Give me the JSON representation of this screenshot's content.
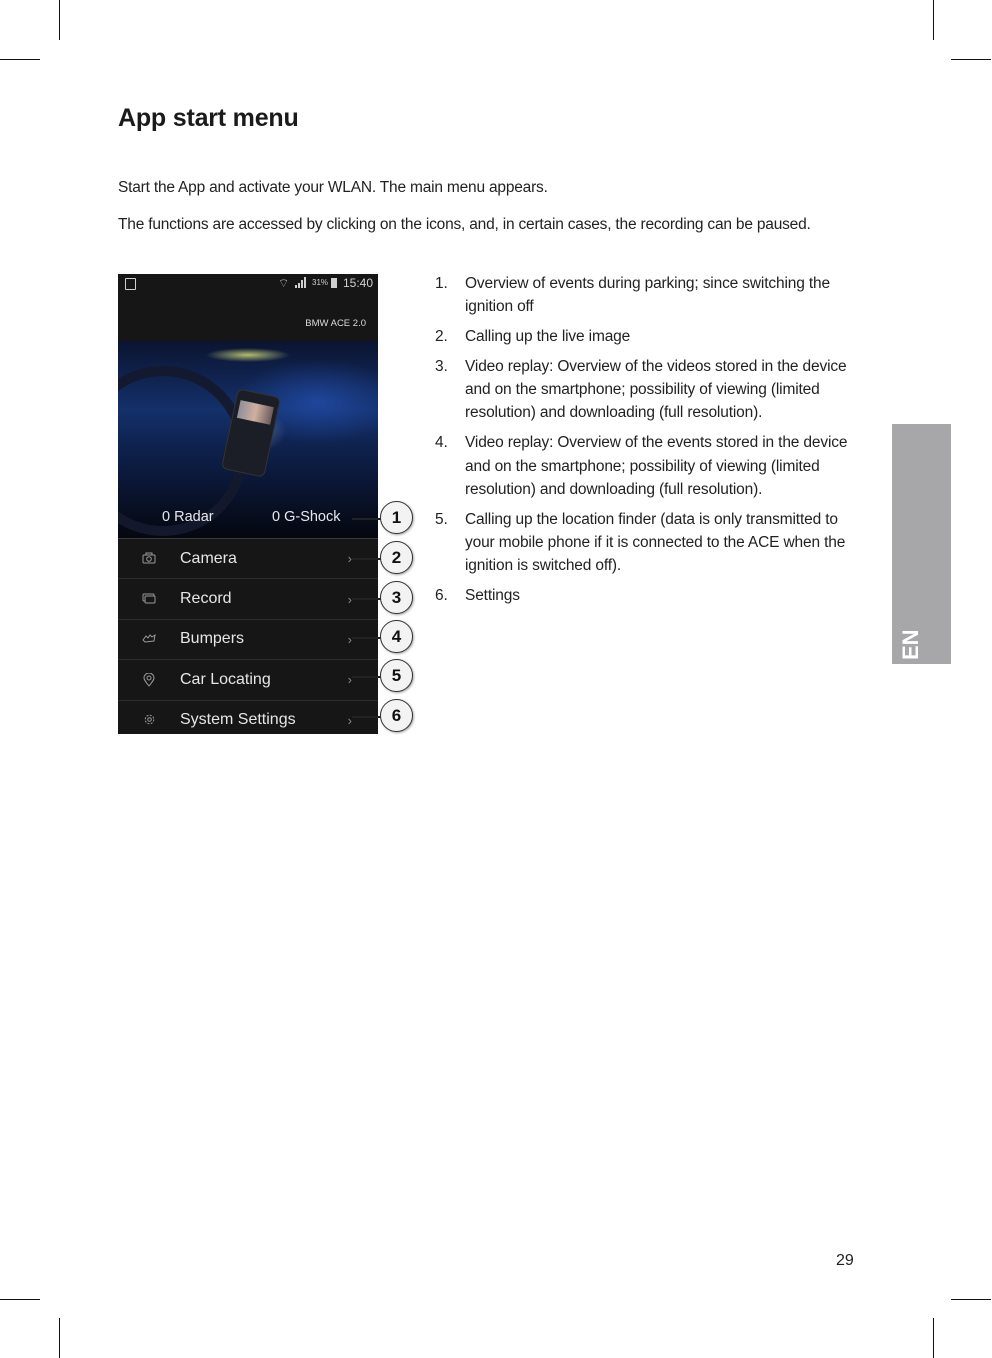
{
  "page": {
    "title": "App start menu",
    "paragraphs": [
      "Start the App and activate your WLAN. The main menu appears.",
      "The functions are accessed by clicking on the icons, and, in certain cases, the recording can be paused."
    ],
    "language_tab": "EN",
    "page_number": "29"
  },
  "phone": {
    "status_bar": {
      "battery_percent": "31%",
      "time": "15:40",
      "icons": [
        "notification-icon",
        "wifi-icon",
        "signal-icon",
        "battery-icon"
      ]
    },
    "device_name": "BMW ACE 2.0",
    "counters": {
      "radar": "0 Radar",
      "gshock": "0 G-Shock"
    },
    "menu_items": [
      {
        "label": "Camera",
        "icon": "camera-icon",
        "callout": "2"
      },
      {
        "label": "Record",
        "icon": "record-icon",
        "callout": "3"
      },
      {
        "label": "Bumpers",
        "icon": "bumper-icon",
        "callout": "4"
      },
      {
        "label": "Car Locating",
        "icon": "location-pin-icon",
        "callout": "5"
      },
      {
        "label": "System Settings",
        "icon": "gear-icon",
        "callout": "6"
      }
    ],
    "chevron": "›",
    "counter_callout": "1"
  },
  "descriptions": [
    {
      "num": "1.",
      "text": "Overview of events during parking; since switching the ignition off"
    },
    {
      "num": "2.",
      "text": "Calling up the live image"
    },
    {
      "num": "3.",
      "text": "Video replay: Overview of the videos stored in the device and on the smartphone; possibility of viewing (limited resolution) and downloading (full resolution)."
    },
    {
      "num": "4.",
      "text": "Video replay: Overview of the events stored in the device and on the smartphone; possibility of viewing (limited resolution) and downloading (full resolution)."
    },
    {
      "num": "5.",
      "text": "Calling up the location finder (data is only transmitted to your mobile phone if it is connected to the ACE when the ignition is switched off)."
    },
    {
      "num": "6.",
      "text": "Settings"
    }
  ]
}
